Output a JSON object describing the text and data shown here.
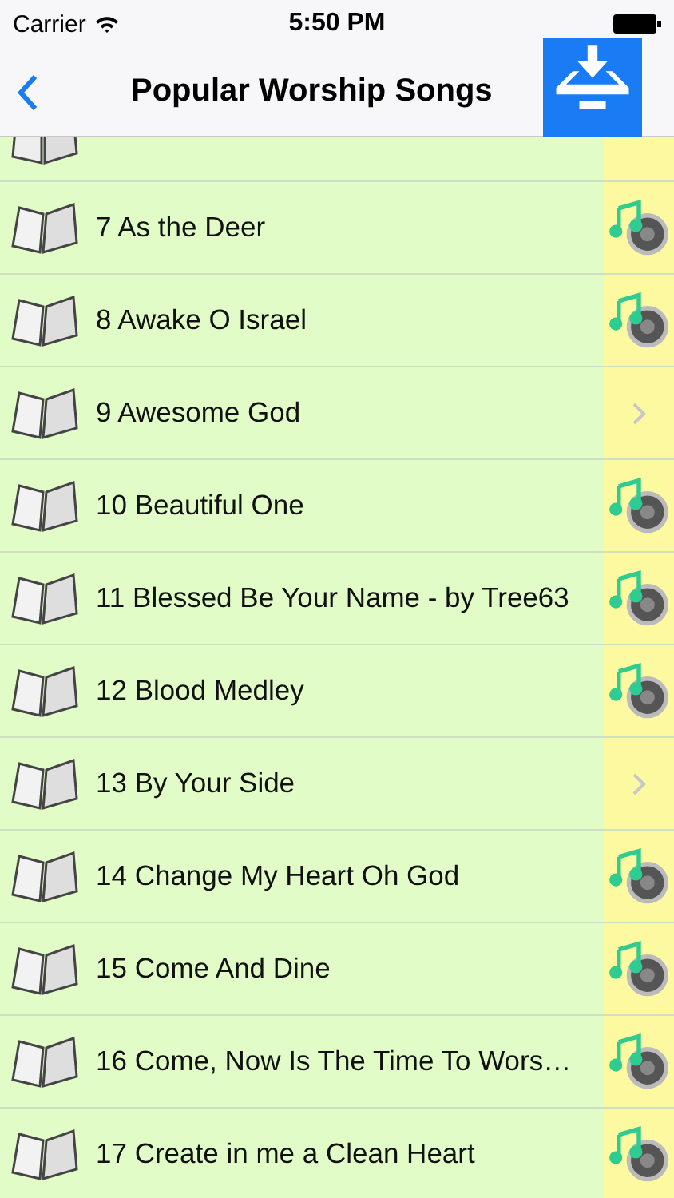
{
  "status_bar": {
    "carrier": "Carrier",
    "time": "5:50 PM"
  },
  "nav_bar": {
    "title": "Popular Worship Songs"
  },
  "songs": [
    {
      "title": "7 As the Deer",
      "kind": "audio"
    },
    {
      "title": "8 Awake O Israel",
      "kind": "audio"
    },
    {
      "title": "9 Awesome God",
      "kind": "chevron"
    },
    {
      "title": "10 Beautiful One",
      "kind": "audio"
    },
    {
      "title": "11 Blessed Be Your Name - by Tree63",
      "kind": "audio"
    },
    {
      "title": "12 Blood Medley",
      "kind": "audio"
    },
    {
      "title": "13 By Your Side",
      "kind": "chevron"
    },
    {
      "title": "14 Change My Heart Oh God",
      "kind": "audio"
    },
    {
      "title": "15 Come And Dine",
      "kind": "audio"
    },
    {
      "title": "16 Come, Now Is The Time To Wors…",
      "kind": "audio"
    },
    {
      "title": "17 Create in me a Clean Heart",
      "kind": "audio"
    }
  ]
}
